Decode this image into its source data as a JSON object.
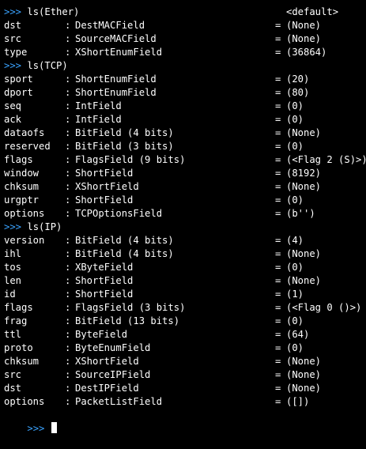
{
  "colors": {
    "background": "#000000",
    "text": "#ffffff",
    "prompt": "#3aa3ff"
  },
  "prompt_symbol": ">>>",
  "truncated_top_line": "<default>",
  "sections": [
    {
      "command": "ls(Ether)",
      "fields": [
        {
          "name": "dst",
          "type": "DestMACField",
          "default": "(None)"
        },
        {
          "name": "src",
          "type": "SourceMACField",
          "default": "(None)"
        },
        {
          "name": "type",
          "type": "XShortEnumField",
          "default": "(36864)"
        }
      ]
    },
    {
      "command": "ls(TCP)",
      "fields": [
        {
          "name": "sport",
          "type": "ShortEnumField",
          "default": "(20)"
        },
        {
          "name": "dport",
          "type": "ShortEnumField",
          "default": "(80)"
        },
        {
          "name": "seq",
          "type": "IntField",
          "default": "(0)"
        },
        {
          "name": "ack",
          "type": "IntField",
          "default": "(0)"
        },
        {
          "name": "dataofs",
          "type": "BitField (4 bits)",
          "default": "(None)"
        },
        {
          "name": "reserved",
          "type": "BitField (3 bits)",
          "default": "(0)"
        },
        {
          "name": "flags",
          "type": "FlagsField (9 bits)",
          "default": "(<Flag 2 (S)>)"
        },
        {
          "name": "window",
          "type": "ShortField",
          "default": "(8192)"
        },
        {
          "name": "chksum",
          "type": "XShortField",
          "default": "(None)"
        },
        {
          "name": "urgptr",
          "type": "ShortField",
          "default": "(0)"
        },
        {
          "name": "options",
          "type": "TCPOptionsField",
          "default": "(b'')"
        }
      ]
    },
    {
      "command": "ls(IP)",
      "fields": [
        {
          "name": "version",
          "type": "BitField (4 bits)",
          "default": "(4)"
        },
        {
          "name": "ihl",
          "type": "BitField (4 bits)",
          "default": "(None)"
        },
        {
          "name": "tos",
          "type": "XByteField",
          "default": "(0)"
        },
        {
          "name": "len",
          "type": "ShortField",
          "default": "(None)"
        },
        {
          "name": "id",
          "type": "ShortField",
          "default": "(1)"
        },
        {
          "name": "flags",
          "type": "FlagsField (3 bits)",
          "default": "(<Flag 0 ()>)"
        },
        {
          "name": "frag",
          "type": "BitField (13 bits)",
          "default": "(0)"
        },
        {
          "name": "ttl",
          "type": "ByteField",
          "default": "(64)"
        },
        {
          "name": "proto",
          "type": "ByteEnumField",
          "default": "(0)"
        },
        {
          "name": "chksum",
          "type": "XShortField",
          "default": "(None)"
        },
        {
          "name": "src",
          "type": "SourceIPField",
          "default": "(None)"
        },
        {
          "name": "dst",
          "type": "DestIPField",
          "default": "(None)"
        },
        {
          "name": "options",
          "type": "PacketListField",
          "default": "([])"
        }
      ]
    }
  ]
}
